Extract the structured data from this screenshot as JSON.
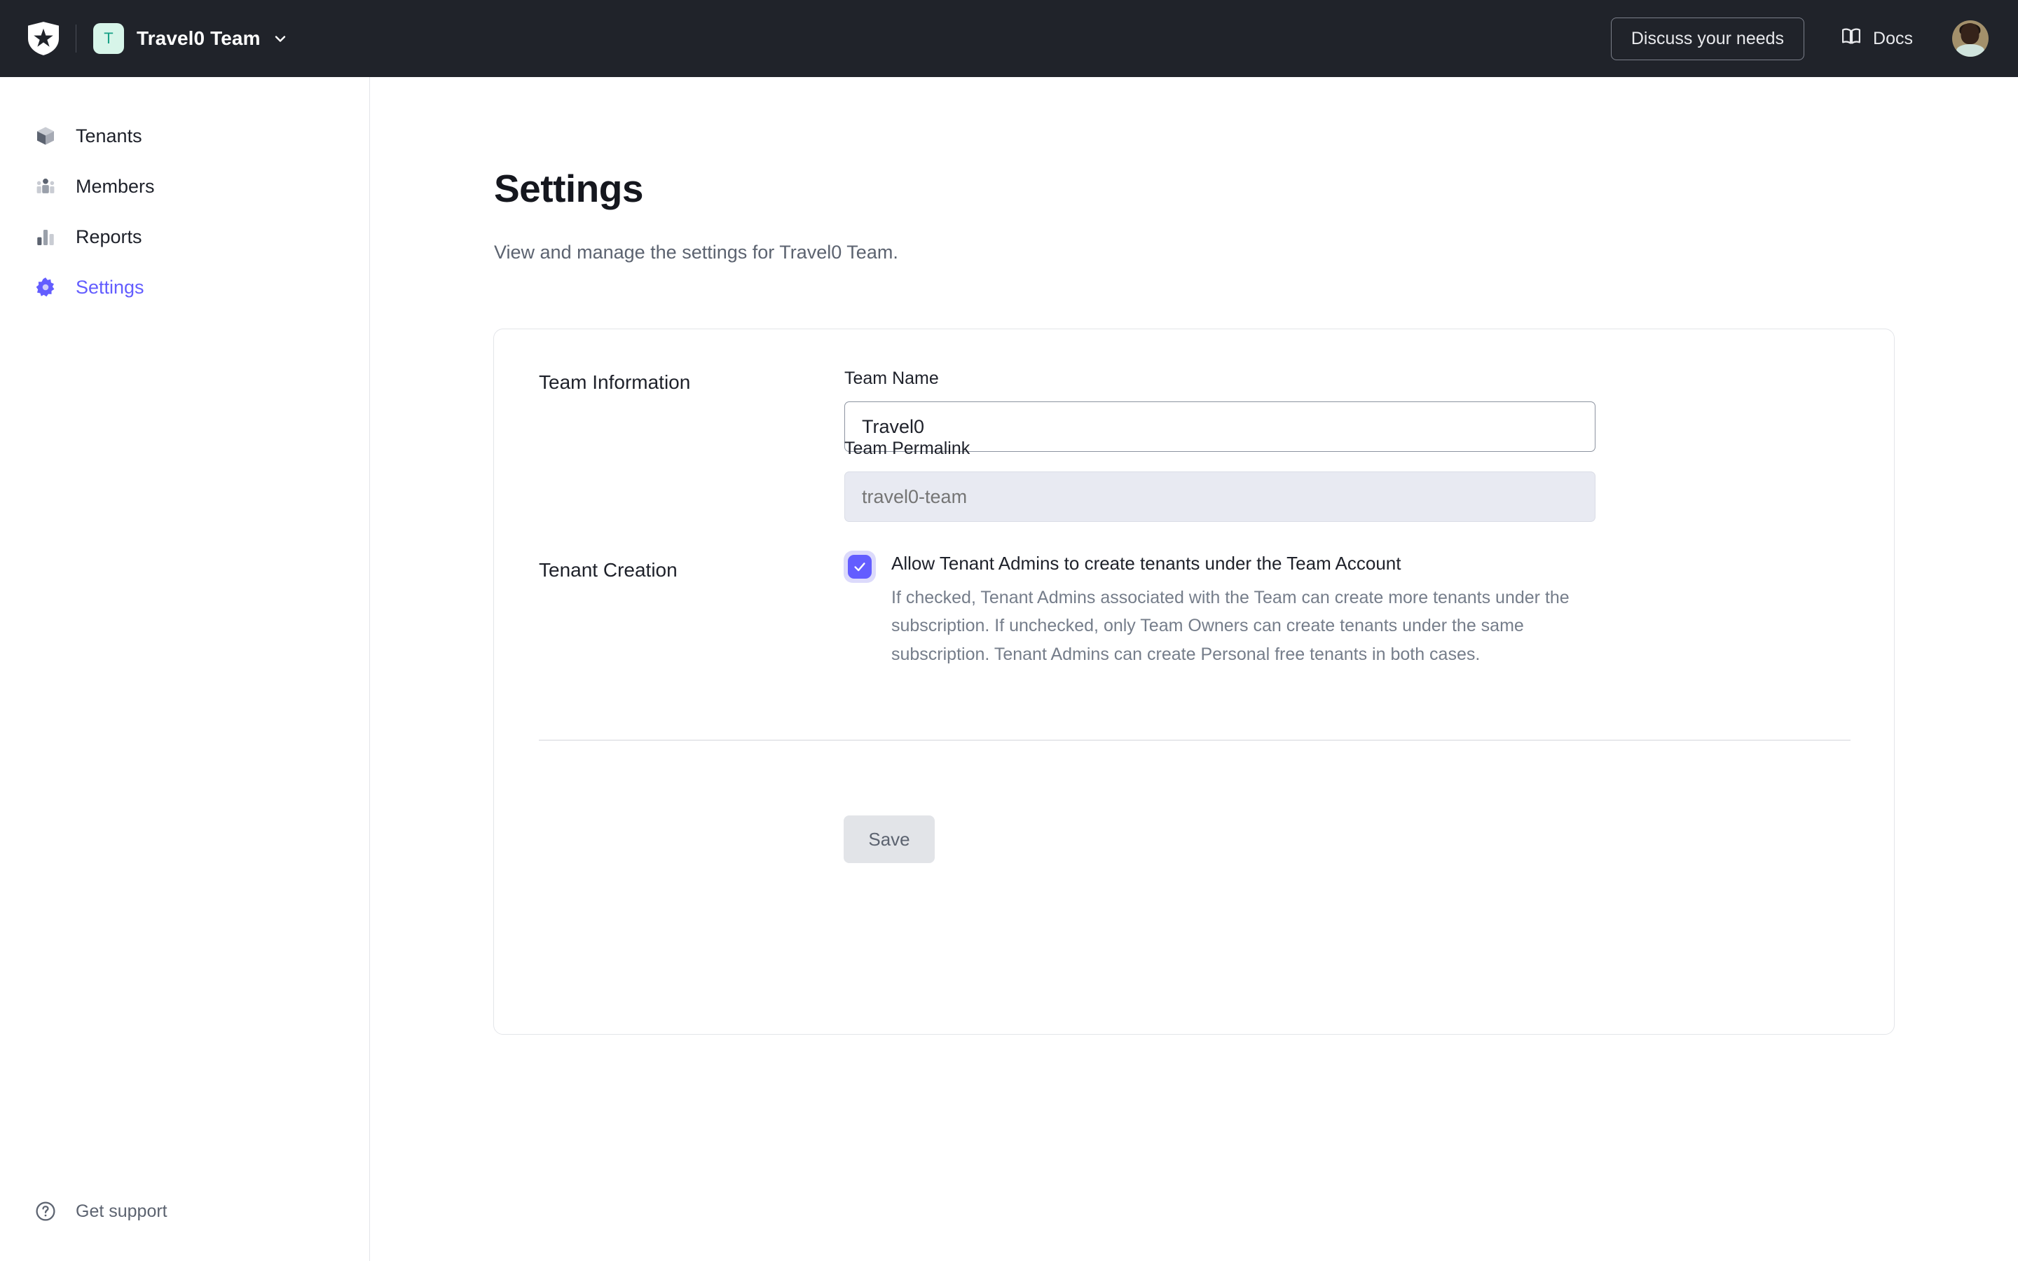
{
  "header": {
    "logo_icon": "auth0-shield-logo",
    "team_badge_letter": "T",
    "team_name": "Travel0 Team",
    "team_caret_icon": "chevron-down-icon",
    "discuss_label": "Discuss your needs",
    "docs_icon": "book-icon",
    "docs_label": "Docs",
    "avatar_icon": "user-avatar"
  },
  "sidebar": {
    "items": [
      {
        "label": "Tenants",
        "icon": "cube-icon",
        "active": false
      },
      {
        "label": "Members",
        "icon": "people-icon",
        "active": false
      },
      {
        "label": "Reports",
        "icon": "bar-chart-icon",
        "active": false
      },
      {
        "label": "Settings",
        "icon": "gear-icon",
        "active": true
      }
    ],
    "support": {
      "label": "Get support",
      "icon": "question-circle-icon"
    }
  },
  "main": {
    "title": "Settings",
    "subtitle": "View and manage the settings for Travel0 Team.",
    "team_information": {
      "section_label": "Team Information",
      "team_name_label": "Team Name",
      "team_name_value": "Travel0",
      "team_name_placeholder": "Team Name",
      "permalink_label": "Team Permalink",
      "permalink_value": "",
      "permalink_placeholder": "travel0-team"
    },
    "tenant_creation": {
      "section_label": "Tenant Creation",
      "checkbox_checked": true,
      "checkbox_label": "Allow Tenant Admins to create tenants under the Team Account",
      "checkbox_description": "If checked, Tenant Admins associated with the Team can create more tenants under the subscription. If unchecked, only Team Owners can create tenants under the same subscription. Tenant Admins can create Personal free tenants in both cases.",
      "save_label": "Save"
    }
  },
  "colors": {
    "header_bg": "#20232A",
    "accent": "#635DFF",
    "badge_bg": "#D7F5E9",
    "badge_fg": "#16A085",
    "disabled_field_bg": "#E8EAF2",
    "save_disabled_bg": "#E2E4E8"
  }
}
